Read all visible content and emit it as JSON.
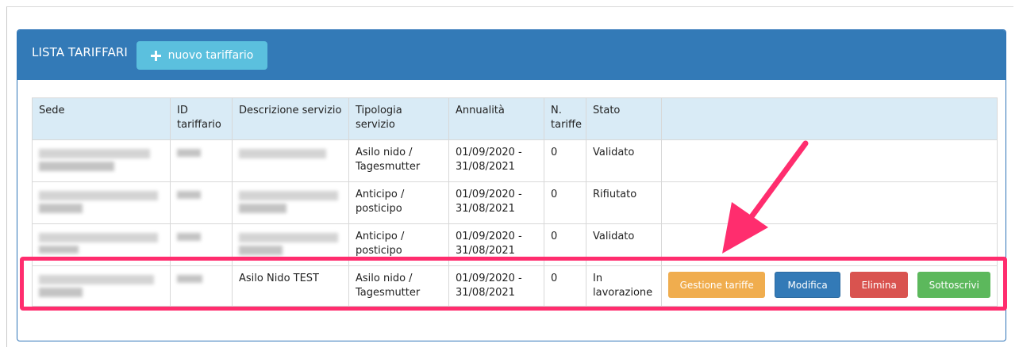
{
  "panel": {
    "title": "LISTA TARIFFARI",
    "new_button_label": "nuovo tariffario"
  },
  "table": {
    "headers": [
      "Sede",
      "ID tariffario",
      "Descrizione servizio",
      "Tipologia servizio",
      "Annualità",
      "N. tariffe",
      "Stato",
      ""
    ],
    "rows": [
      {
        "sede": "",
        "id": "",
        "descrizione": "",
        "tipologia": "Asilo nido / Tagesmutter",
        "annualita": "01/09/2020 - 31/08/2021",
        "n_tariffe": "0",
        "stato": "Validato"
      },
      {
        "sede": "",
        "id": "",
        "descrizione": "",
        "tipologia": "Anticipo / posticipo",
        "annualita": "01/09/2020 - 31/08/2021",
        "n_tariffe": "0",
        "stato": "Rifiutato"
      },
      {
        "sede": "",
        "id": "",
        "descrizione": "",
        "tipologia": "Anticipo / posticipo",
        "annualita": "01/09/2020 - 31/08/2021",
        "n_tariffe": "0",
        "stato": "Validato"
      },
      {
        "sede": "",
        "id": "",
        "descrizione": "Asilo Nido TEST",
        "tipologia": "Asilo nido / Tagesmutter",
        "annualita": "01/09/2020 - 31/08/2021",
        "n_tariffe": "0",
        "stato": "In lavorazione"
      }
    ]
  },
  "actions": {
    "manage": "Gestione tariffe",
    "edit": "Modifica",
    "delete": "Elimina",
    "sign": "Sottoscrivi"
  },
  "colors": {
    "panel_heading": "#337ab7",
    "new_button": "#5bc0de",
    "manage": "#f0ad4e",
    "edit": "#337ab7",
    "delete": "#d9534f",
    "sign": "#5cb85c",
    "annotation": "#ff2d6e"
  },
  "icons": {
    "new_button": "plus-icon",
    "annotation": "arrow-annotation"
  }
}
